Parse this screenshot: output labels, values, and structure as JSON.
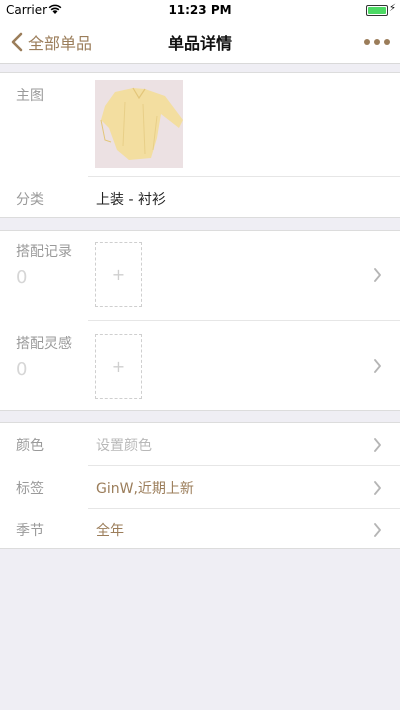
{
  "status_bar": {
    "carrier": "Carrier",
    "time": "11:23 PM",
    "battery_level": 1.0
  },
  "nav": {
    "back_label": "全部单品",
    "title": "单品详情"
  },
  "photo_section": {
    "main_image_label": "主图",
    "category_label": "分类",
    "category_value": "上装 - 衬衫"
  },
  "outfit_section": {
    "records_label": "搭配记录",
    "records_count": "0",
    "inspiration_label": "搭配灵感",
    "inspiration_count": "0",
    "add_symbol": "+"
  },
  "attributes_section": {
    "color_label": "颜色",
    "color_placeholder": "设置颜色",
    "tags_label": "标签",
    "tags_value": "GinW,近期上新",
    "season_label": "季节",
    "season_value": "全年"
  },
  "colors": {
    "accent": "#9b7d5a",
    "background": "#efeef4",
    "battery": "#4cd964"
  }
}
